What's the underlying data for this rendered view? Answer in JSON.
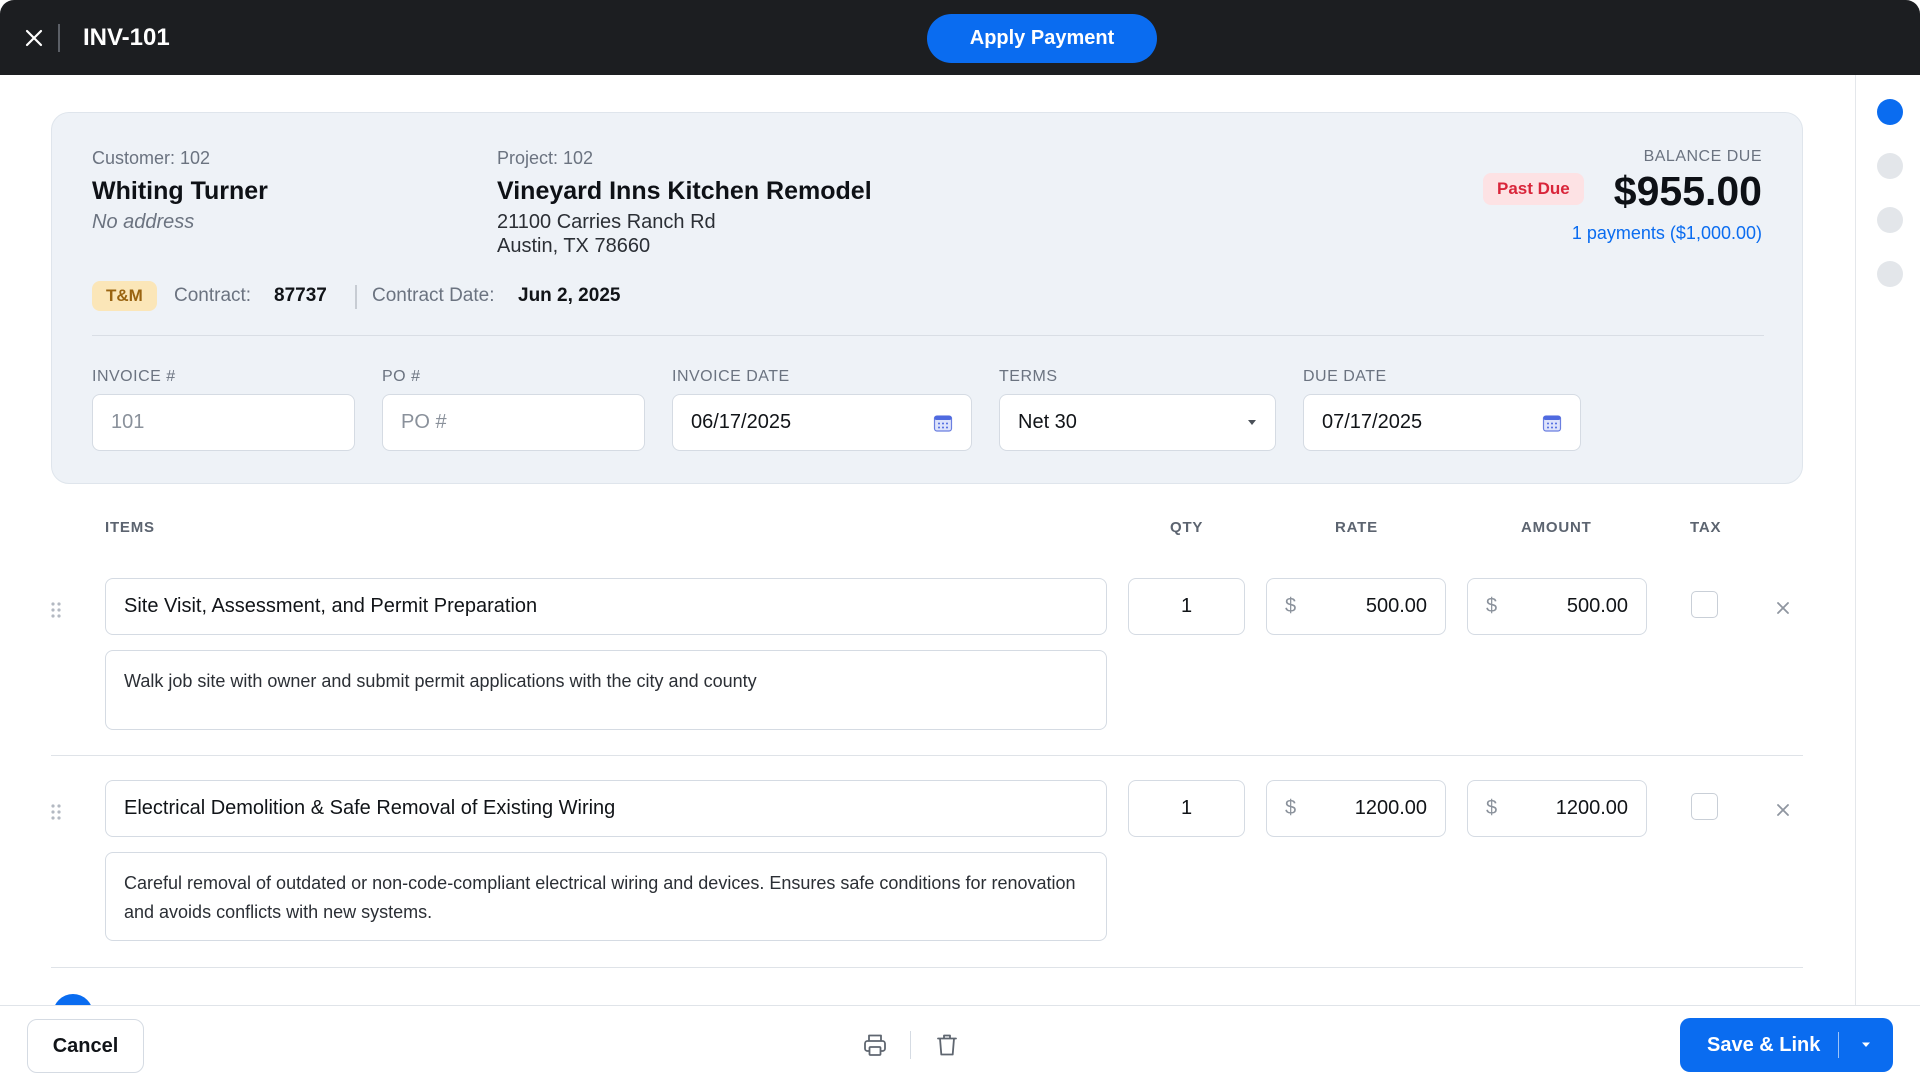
{
  "header": {
    "invoice_title": "INV-101",
    "apply_payment_label": "Apply Payment"
  },
  "summary": {
    "customer_label": "Customer: 102",
    "customer_name": "Whiting Turner",
    "customer_address": "No address",
    "project_label": "Project: 102",
    "project_name": "Vineyard Inns Kitchen Remodel",
    "project_address_line1": "21100 Carries Ranch Rd",
    "project_address_line2": "Austin, TX 78660",
    "balance_label": "BALANCE DUE",
    "status_badge": "Past Due",
    "balance_amount": "$955.00",
    "payments_link": "1 payments ($1,000.00)",
    "billing_type_badge": "T&M",
    "contract_label": "Contract:",
    "contract_value": "87737",
    "contract_date_label": "Contract Date:",
    "contract_date_value": "Jun 2, 2025"
  },
  "fields": {
    "invoice_number": {
      "label": "INVOICE #",
      "placeholder": "101"
    },
    "po_number": {
      "label": "PO #",
      "placeholder": "PO #"
    },
    "invoice_date": {
      "label": "INVOICE DATE",
      "value": "06/17/2025"
    },
    "terms": {
      "label": "TERMS",
      "value": "Net 30"
    },
    "due_date": {
      "label": "DUE DATE",
      "value": "07/17/2025"
    }
  },
  "table": {
    "headers": {
      "items": "ITEMS",
      "qty": "QTY",
      "rate": "RATE",
      "amount": "AMOUNT",
      "tax": "TAX"
    },
    "currency_symbol": "$",
    "rows": [
      {
        "name": "Site Visit, Assessment, and Permit Preparation",
        "description": "Walk job site with owner and submit permit applications with the city and county",
        "qty": "1",
        "rate": "500.00",
        "amount": "500.00",
        "tax": false
      },
      {
        "name": "Electrical Demolition & Safe Removal of Existing Wiring",
        "description": "Careful removal of outdated or non-code-compliant electrical wiring and devices. Ensures safe conditions for renovation and avoids conflicts with new systems.",
        "qty": "1",
        "rate": "1200.00",
        "amount": "1200.00",
        "tax": false
      }
    ]
  },
  "footer": {
    "cancel_label": "Cancel",
    "save_label": "Save & Link"
  },
  "icons": {
    "close": "close-icon",
    "calendar": "calendar-icon",
    "dropdown": "chevron-down-icon",
    "drag": "drag-handle-icon",
    "remove": "remove-icon",
    "print": "print-icon",
    "trash": "trash-icon"
  },
  "colors": {
    "accent": "#0a6cf0",
    "header_bg": "#1c1e21",
    "past_due_bg": "#fde2e4",
    "past_due_text": "#d9253a",
    "tm_badge_bg": "#fbe6b8",
    "card_bg": "#eef2f7"
  }
}
